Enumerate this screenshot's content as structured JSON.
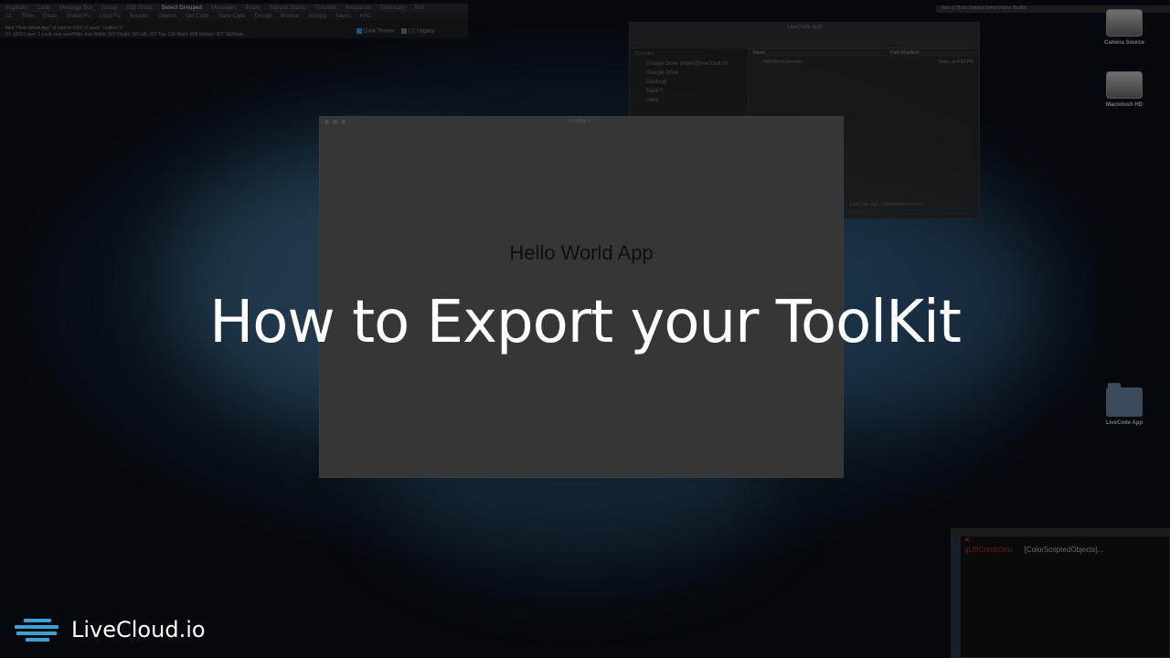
{
  "toolbar": {
    "row1": [
      "Inspector",
      "Code",
      "Message Box",
      "Group",
      "Edit Group",
      "Select Grouped",
      "Messages",
      "Errors",
      "Sample Stacks",
      "Tutorials",
      "Resources",
      "Dictionary",
      "Test"
    ],
    "row2": [
      "LC",
      "Time",
      "Clean",
      "Global Fu",
      "Local Fu",
      "Sockets",
      "Objects",
      "Get Code",
      "Save Code",
      "Design",
      "Browse",
      "SetApp",
      "Saves",
      "HAC"
    ],
    "info_line1": "field \"Hello World App\" of card id 1002 of stack \"Untitled 1\"",
    "info_line2": "ID: 1003   Layer: 1   Lock: true   autoHilite: true   Width: 520   Height: 68   Left: 207   Top: 236   Right: 808   Bottom: 307   TabStops",
    "dark_theme": "Dark Theme",
    "lc_legacy": "LC Legacy"
  },
  "finder": {
    "title": "LiveCode App",
    "favorites_header": "Favorites",
    "sidebar": [
      "Google Drive (mark@livecloud.io)",
      "Google Drive",
      "Desktop",
      "Mark T",
      "mark"
    ],
    "col_name": "Name",
    "col_date": "Date Modified",
    "file_name": "HelloWorld.livecode",
    "file_date": "Today at 4:08 PM",
    "path": "LiveCode App  ›  HelloWorld.livecode"
  },
  "app_window": {
    "title": "Untitled 1 *",
    "field_text": "Hello World App"
  },
  "overlay_title": "How to Export your ToolKit",
  "desktop": {
    "icon1": "Camera Source",
    "icon2": "Macintosh HD",
    "icon3": "LiveCode App"
  },
  "message_box": {
    "error_text": "gUBCondiOmc",
    "content": "[ColorScriptedObjects]..."
  },
  "topbar": "New   LCB on   Untitled   Select    Home   ToolKit",
  "logo": {
    "text": "LiveCloud.io",
    "color": "#3aa3d6"
  }
}
